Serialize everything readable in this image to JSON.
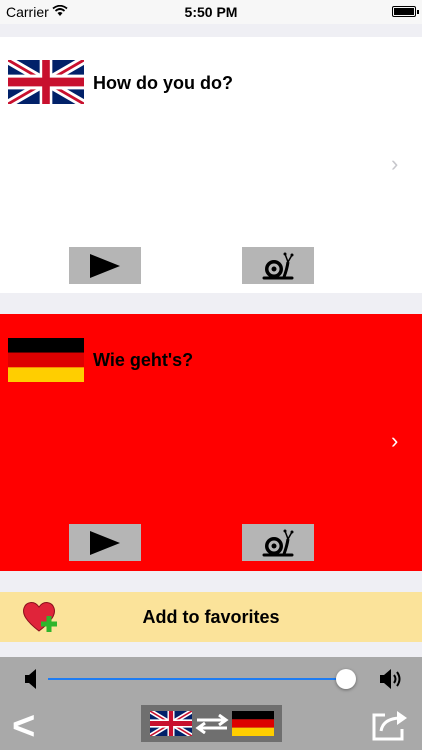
{
  "status_bar": {
    "carrier": "Carrier",
    "time": "5:50 PM"
  },
  "source": {
    "language": "English",
    "phrase": "How do you do?",
    "flag_icon": "uk-flag-icon"
  },
  "target": {
    "language": "German",
    "phrase": "Wie geht's?",
    "flag_icon": "germany-flag-icon"
  },
  "colors": {
    "source_bg": "#ffffff",
    "target_bg": "#ff0000",
    "favorites_bg": "#fbe39a",
    "toolbar_bg": "#a9a9a9",
    "slider_accent": "#1e7cf2"
  },
  "favorites": {
    "label": "Add to favorites",
    "icon": "heart-plus-icon"
  },
  "toolbar": {
    "back_label": "<",
    "volume_level": 0.98
  }
}
